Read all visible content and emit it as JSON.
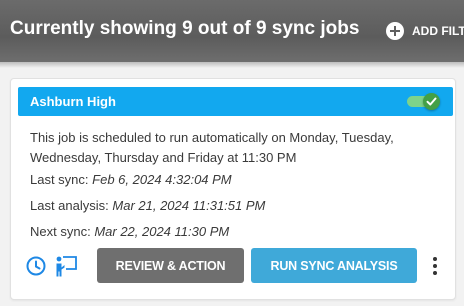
{
  "header": {
    "title": "Currently showing 9 out of 9 sync jobs",
    "add_filter_label": "ADD FILT",
    "background": "#5f5f5f"
  },
  "job_card": {
    "name": "Ashburn High",
    "header_color": "#12a8ef",
    "enabled": true,
    "schedule_text": "This job is scheduled to run automatically on Monday, Tuesday, Wednesday, Thursday and Friday at 11:30 PM",
    "last_sync_label": "Last sync:",
    "last_sync_value": "Feb 6, 2024 4:32:04 PM",
    "last_analysis_label": "Last analysis:",
    "last_analysis_value": "Mar 21, 2024 11:31:51 PM",
    "next_sync_label": "Next sync:",
    "next_sync_value": "Mar 22, 2024 11:30 PM",
    "icons": [
      "clock-icon",
      "presentation-icon",
      "more-vert-icon"
    ],
    "review_button": "REVIEW & ACTION",
    "review_color": "#6f6f6f",
    "run_button": "RUN SYNC ANALYSIS",
    "run_color": "#3fa9d9"
  }
}
